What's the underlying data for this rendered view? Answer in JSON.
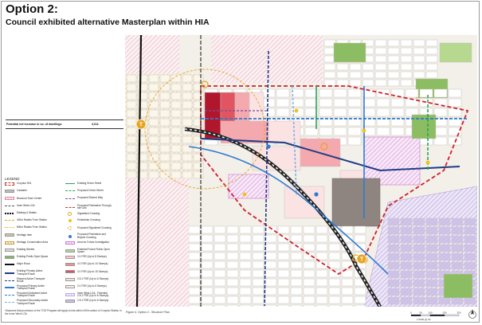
{
  "header": {
    "title": "Option 2:",
    "subtitle": "Council exhibited alternative Masterplan within HIA"
  },
  "dwellings": {
    "label": "Potential net increase in no. of dwellings",
    "value": "3,611"
  },
  "legend": {
    "title": "LEGEND",
    "col1": [
      {
        "label": "Croydon HIA",
        "color": "#c0392b",
        "style": "dash-box"
      },
      {
        "label": "Cadastre",
        "color": "#bbbbbb",
        "style": "box"
      },
      {
        "label": "Burwood Town Centre",
        "color": "#d68fa0",
        "style": "hatch"
      },
      {
        "label": "Inner West LGA",
        "color": "#555555",
        "style": "dash"
      },
      {
        "label": "Railway & Station",
        "color": "#111111",
        "style": "rail"
      },
      {
        "label": "400m Radius From Station",
        "color": "#e6a420",
        "style": "dash"
      },
      {
        "label": "800m Radius From Station",
        "color": "#e6a420",
        "style": "dot"
      },
      {
        "label": "Heritage Item",
        "color": "#cfc3a8",
        "style": "box"
      },
      {
        "label": "Heritage Conservation Area",
        "color": "#c9a13b",
        "style": "hatch"
      },
      {
        "label": "Existing Streets",
        "color": "#dddddd",
        "style": "box"
      },
      {
        "label": "Existing Public Open Space",
        "color": "#86b95e",
        "style": "box"
      },
      {
        "label": "Major Road",
        "color": "#111111",
        "style": "line"
      },
      {
        "label": "Existing Primary Active Transport Route",
        "color": "#1f3c88",
        "style": "line"
      },
      {
        "label": "Planned Active Transport Route",
        "color": "#1f3c88",
        "style": "dash"
      },
      {
        "label": "Proposed Primary Active Transport Route",
        "color": "#2f7bd1",
        "style": "line"
      },
      {
        "label": "Proposed Dedicated Active Transport Route",
        "color": "#2f7bd1",
        "style": "dash"
      },
      {
        "label": "Proposed Secondary Active Transport Route",
        "color": "#7fb2e5",
        "style": "dash"
      }
    ],
    "col2": [
      {
        "label": "Existing Green Street",
        "color": "#2aa35a",
        "style": "arrow"
      },
      {
        "label": "Proposed Green Street",
        "color": "#2aa35a",
        "style": "dash-arrow"
      },
      {
        "label": "Proposed Shared Way",
        "color": "#7a4fa0",
        "style": "dash"
      },
      {
        "label": "Proposed Pedestrian Through-site Link",
        "color": "#c0392b",
        "style": "dash-arrow"
      },
      {
        "label": "Signalised Crossing",
        "color": "#e6a420",
        "style": "ring"
      },
      {
        "label": "Pedestrian Crossing",
        "color": "#f0c419",
        "style": "circle"
      },
      {
        "label": "Proposed Signalised Crossing",
        "color": "#e6a420",
        "style": "dash-ring"
      },
      {
        "label": "Proposed Pedestrian and Bicycle Crossing",
        "color": "#2f7bd1",
        "style": "circle"
      },
      {
        "label": "Area for Future Investigation",
        "color": "#d27bd3",
        "style": "hatch"
      },
      {
        "label": "Potential Future Public Open Space",
        "color": "#b6d88f",
        "style": "box"
      },
      {
        "label": "3:1 FSR (Up to 8 Storeys)",
        "color": "#f8c9c9",
        "style": "box"
      },
      {
        "label": "4:1 FSR (Up to 10 Storeys)",
        "color": "#f09090",
        "style": "box"
      },
      {
        "label": "3:1 FSR (Up to 15 Storeys)",
        "color": "#e0505a",
        "style": "box"
      },
      {
        "label": "2.5:1 FSR (Up to 6 Storeys)",
        "color": "#f9dede",
        "style": "box"
      },
      {
        "label": "2:1 FSR (Up to 6 Storeys)",
        "color": "#fbe9e9",
        "style": "box"
      },
      {
        "label": "Inner West LGA - Potential 2.5:1 FSR (Up to 6 Storeys)",
        "color": "#b9a9df",
        "style": "hatch"
      },
      {
        "label": "2.5:1 FSR (Up to 6 Storeys)",
        "color": "#ccc0ea",
        "style": "box"
      }
    ]
  },
  "footnote": "*Assumes that provisions of the TOD Program will apply to lots within 400m radius of Croydon Station in the Inner West LGA",
  "map": {
    "caption": "Figure 4.    Option 2 - Structure Plan",
    "scale_labels": [
      "0",
      "50",
      "100",
      "200",
      "300"
    ],
    "scale_title": "1:6000 @ A3",
    "station_marker": "T",
    "colors": {
      "paper": "#f3efe9",
      "lot": "#ffffff",
      "lot_stroke": "#c7c2bb",
      "heritage": "#f5e7c7",
      "pink_light": "#fbe3e4",
      "pink_mid": "#f4a9ae",
      "red_mid": "#e05560",
      "red_dark": "#b0162c",
      "purple": "#cbbfe6",
      "green": "#8dbd62",
      "grey_dark": "#8e8580",
      "blue": "#2f7bd1",
      "navy": "#1f3c88",
      "hia": "#d0202c",
      "orange": "#e6a420"
    }
  }
}
